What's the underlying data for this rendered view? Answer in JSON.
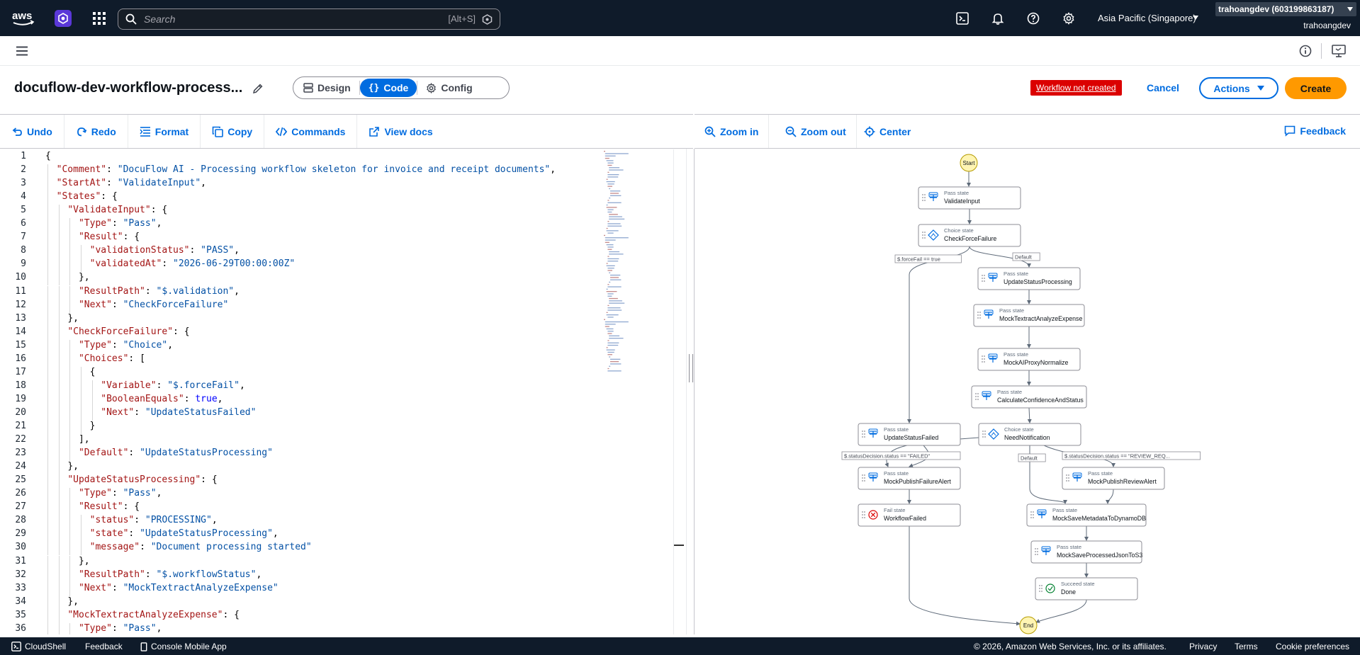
{
  "topnav": {
    "search_placeholder": "Search",
    "search_shortcut": "[Alt+S]",
    "region": "Asia Pacific (Singapore)",
    "account": "trahoangdev (603199863187)",
    "user": "trahoangdev"
  },
  "header": {
    "title": "docuflow-dev-workflow-process...",
    "modes": [
      "Design",
      "Code",
      "Config"
    ],
    "active_mode": "Code",
    "status_badge": "Workflow not created",
    "cancel_label": "Cancel",
    "actions_label": "Actions",
    "create_label": "Create"
  },
  "editor_toolbar": {
    "undo": "Undo",
    "redo": "Redo",
    "format": "Format",
    "copy": "Copy",
    "commands": "Commands",
    "view_docs": "View docs"
  },
  "graph_toolbar": {
    "zoom_in": "Zoom in",
    "zoom_out": "Zoom out",
    "center": "Center",
    "feedback": "Feedback"
  },
  "code_lines": [
    "{",
    "  \"Comment\": \"DocuFlow AI - Processing workflow skeleton for invoice and receipt documents\",",
    "  \"StartAt\": \"ValidateInput\",",
    "  \"States\": {",
    "    \"ValidateInput\": {",
    "      \"Type\": \"Pass\",",
    "      \"Result\": {",
    "        \"validationStatus\": \"PASS\",",
    "        \"validatedAt\": \"2026-06-29T00:00:00Z\"",
    "      },",
    "      \"ResultPath\": \"$.validation\",",
    "      \"Next\": \"CheckForceFailure\"",
    "    },",
    "    \"CheckForceFailure\": {",
    "      \"Type\": \"Choice\",",
    "      \"Choices\": [",
    "        {",
    "          \"Variable\": \"$.forceFail\",",
    "          \"BooleanEquals\": true,",
    "          \"Next\": \"UpdateStatusFailed\"",
    "        }",
    "      ],",
    "      \"Default\": \"UpdateStatusProcessing\"",
    "    },",
    "    \"UpdateStatusProcessing\": {",
    "      \"Type\": \"Pass\",",
    "      \"Result\": {",
    "        \"status\": \"PROCESSING\",",
    "        \"state\": \"UpdateStatusProcessing\",",
    "        \"message\": \"Document processing started\"",
    "      },",
    "      \"ResultPath\": \"$.workflowStatus\",",
    "      \"Next\": \"MockTextractAnalyzeExpense\"",
    "    },",
    "    \"MockTextractAnalyzeExpense\": {",
    "      \"Type\": \"Pass\","
  ],
  "graph": {
    "start_label": "Start",
    "end_label": "End",
    "nodes": [
      {
        "id": "ValidateInput",
        "type": "Pass state",
        "name": "ValidateInput",
        "kind": "pass"
      },
      {
        "id": "CheckForceFailure",
        "type": "Choice state",
        "name": "CheckForceFailure",
        "kind": "choice"
      },
      {
        "id": "UpdateStatusProcessing",
        "type": "Pass state",
        "name": "UpdateStatusProcessing",
        "kind": "pass"
      },
      {
        "id": "MockTextractAnalyzeExpense",
        "type": "Pass state",
        "name": "MockTextractAnalyzeExpense",
        "kind": "pass"
      },
      {
        "id": "MockAIProxyNormalize",
        "type": "Pass state",
        "name": "MockAIProxyNormalize",
        "kind": "pass"
      },
      {
        "id": "CalculateConfidenceAndStatus",
        "type": "Pass state",
        "name": "CalculateConfidenceAndStatus",
        "kind": "pass"
      },
      {
        "id": "UpdateStatusFailed",
        "type": "Pass state",
        "name": "UpdateStatusFailed",
        "kind": "pass"
      },
      {
        "id": "NeedNotification",
        "type": "Choice state",
        "name": "NeedNotification",
        "kind": "choice"
      },
      {
        "id": "MockPublishFailureAlert",
        "type": "Pass state",
        "name": "MockPublishFailureAlert",
        "kind": "pass"
      },
      {
        "id": "MockPublishReviewAlert",
        "type": "Pass state",
        "name": "MockPublishReviewAlert",
        "kind": "pass"
      },
      {
        "id": "WorkflowFailed",
        "type": "Fail state",
        "name": "WorkflowFailed",
        "kind": "fail"
      },
      {
        "id": "MockSaveMetadataToDynamoDB",
        "type": "Pass state",
        "name": "MockSaveMetadataToDynamoDB",
        "kind": "pass"
      },
      {
        "id": "MockSaveProcessedJsonToS3",
        "type": "Pass state",
        "name": "MockSaveProcessedJsonToS3",
        "kind": "pass"
      },
      {
        "id": "Done",
        "type": "Succeed state",
        "name": "Done",
        "kind": "succeed"
      }
    ],
    "edge_labels": {
      "force_fail": "$.forceFail == true",
      "default_1": "Default",
      "failed": "$.statusDecision.status == \"FAILED\"",
      "default_2": "Default",
      "review": "$.statusDecision.status == \"REVIEW_REQ..."
    }
  },
  "footer": {
    "cloudshell": "CloudShell",
    "feedback": "Feedback",
    "mobile_app": "Console Mobile App",
    "copyright": "© 2026, Amazon Web Services, Inc. or its affiliates.",
    "privacy": "Privacy",
    "terms": "Terms",
    "cookie": "Cookie preferences"
  }
}
